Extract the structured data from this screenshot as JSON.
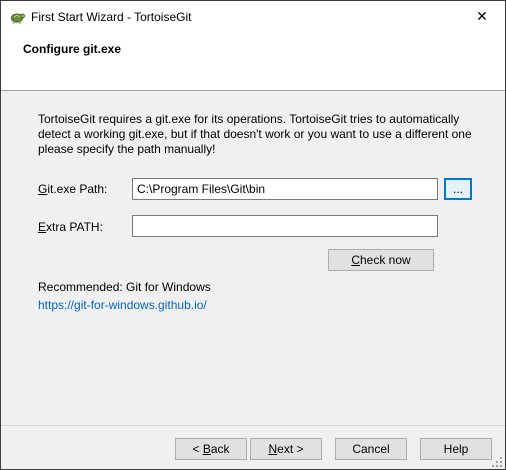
{
  "window": {
    "title": "First Start Wizard - TortoiseGit",
    "app_icon": "tortoise-icon",
    "close_glyph": "✕"
  },
  "header": {
    "title": "Configure git.exe"
  },
  "content": {
    "description": "TortoiseGit requires a git.exe for its operations. TortoiseGit tries to automatically detect a working git.exe, but if that doesn't work or you want to use a different one please specify the path manually!",
    "git_path": {
      "label_accel": "G",
      "label_rest": "it.exe Path:",
      "value": "C:\\Program Files\\Git\\bin"
    },
    "browse_label": "...",
    "extra_path": {
      "label_accel": "E",
      "label_rest": "xtra PATH:",
      "value": ""
    },
    "check_now": {
      "accel": "C",
      "rest": "heck now"
    },
    "recommended": "Recommended: Git for Windows",
    "link": "https://git-for-windows.github.io/"
  },
  "footer": {
    "back": {
      "prefix": "< ",
      "accel": "B",
      "rest": "ack"
    },
    "next": {
      "accel": "N",
      "rest": "ext >"
    },
    "cancel": "Cancel",
    "help": "Help"
  },
  "colors": {
    "accent": "#0078d7",
    "link": "#0066cc"
  }
}
